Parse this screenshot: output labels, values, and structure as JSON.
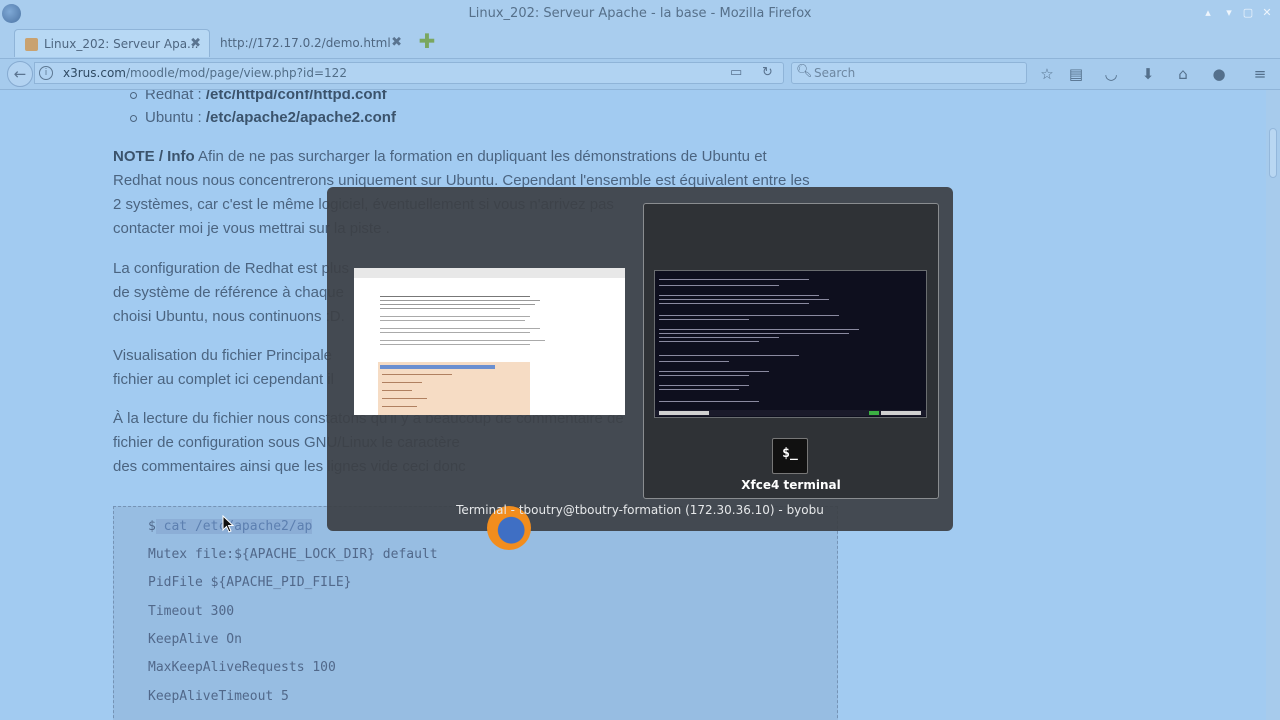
{
  "window": {
    "title": "Linux_202: Serveur Apache - la base - Mozilla Firefox"
  },
  "tabs": [
    {
      "label": "Linux_202: Serveur Apa...",
      "close": "✖"
    },
    {
      "label": "http://172.17.0.2/demo.html",
      "close": "✖"
    }
  ],
  "nav": {
    "url_domain": "x3rus.com",
    "url_path": "/moodle/mod/page/view.php?id=122",
    "search_placeholder": "Search"
  },
  "content": {
    "bullets": [
      {
        "label": "Redhat : ",
        "value": "/etc/httpd/conf/httpd.conf"
      },
      {
        "label": "Ubuntu : ",
        "value": "/etc/apache2/apache2.conf"
      }
    ],
    "note_label": "NOTE / Info",
    "paragraphs": [
      [
        "Afin de ne pas surcharger la formation en dupliquant les démonstrations de Ubuntu et",
        "Redhat nous nous concentrerons uniquement sur Ubuntu. Cependant l'ensemble est équivalent entre les",
        "2 systèmes, car c'est le même logiciel, éventuellement si vous n'arrivez pas",
        "contacter moi je vous mettrai sur la piste ."
      ],
      [
        "La configuration de Redhat est plus",
        "de système de référence à chaque",
        "choisi Ubuntu, nous continuons :D."
      ],
      [
        "Visualisation du fichier Principale",
        "fichier au complet ici cependant il"
      ],
      [
        "À la lecture du fichier nous constatons qu'il y a beaucoup de commentaire de",
        "fichier de configuration sous GNU/Linux le caractère",
        "des commentaires ainsi que les lignes vide ceci donc"
      ]
    ],
    "code_lines": [
      {
        "prefix": "$",
        "selected": " cat /etc/apache2/ap"
      },
      {
        "prefix": "Mutex file:${APACHE_LOCK_DIR} default",
        "selected": ""
      },
      {
        "prefix": "PidFile ${APACHE_PID_FILE}",
        "selected": ""
      },
      {
        "prefix": "Timeout 300",
        "selected": ""
      },
      {
        "prefix": "KeepAlive On",
        "selected": ""
      },
      {
        "prefix": "MaxKeepAliveRequests 100",
        "selected": ""
      },
      {
        "prefix": "KeepAliveTimeout 5",
        "selected": ""
      }
    ]
  },
  "switcher": {
    "selected_app_name": "Xfce4 terminal",
    "terminal_icon_glyph": "$_",
    "caption": "Terminal - tboutry@tboutry-formation (172.30.36.10) - byobu"
  },
  "icons": [
    "firefox-icon",
    "back-arrow-icon",
    "info-icon",
    "reader-view-icon",
    "reload-icon",
    "search-icon",
    "bookmark-star-icon",
    "reading-list-icon",
    "pocket-icon",
    "download-icon",
    "home-icon",
    "chat-icon",
    "menu-icon",
    "new-tab-icon"
  ]
}
